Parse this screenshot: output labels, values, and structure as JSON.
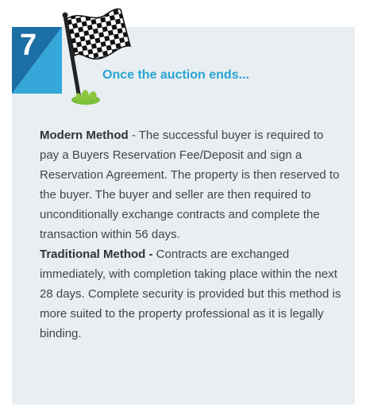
{
  "step": {
    "number": "7",
    "title": "Once the auction ends..."
  },
  "colors": {
    "card_background": "#e8eef1",
    "badge_dark": "#1b6fa5",
    "badge_light": "#35a7d9",
    "heading": "#27a3d3"
  },
  "icons": {
    "flag": "checkered-flag-icon",
    "grass": "grass-tuft-icon"
  },
  "methods": [
    {
      "name": "Modern Method",
      "separator": " - ",
      "description": "The successful buyer is required to pay a Buyers Reservation Fee/Deposit and sign a Reservation Agreement. The property is then reserved to the buyer. The buyer and seller are then required to unconditionally exchange contracts and complete the transaction within 56 days."
    },
    {
      "name": "Traditional Method -",
      "separator": " ",
      "description": "Contracts are exchanged immediately, with completion taking place within the next 28 days. Complete security is provided but this method is more suited to the property professional as it is legally binding."
    }
  ]
}
